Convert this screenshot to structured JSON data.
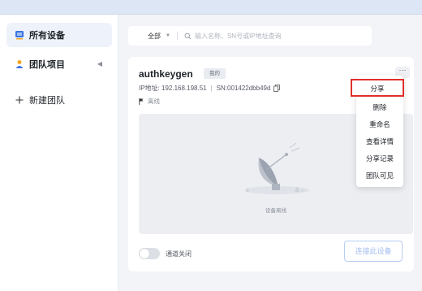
{
  "sidebar": {
    "items": [
      {
        "label": "所有设备",
        "icon": "devices-icon"
      },
      {
        "label": "团队项目",
        "icon": "team-icon"
      },
      {
        "label": "新建团队",
        "icon": "plus-icon"
      }
    ]
  },
  "search": {
    "filter_label": "全部",
    "placeholder": "输入名称、SN号或IP地址查询"
  },
  "device": {
    "name": "authkeygen",
    "badge": "我的",
    "ip_label": "IP地址: 192.168.198.51",
    "sn_label": "SN:001422dbb49d",
    "status": "离线",
    "preview_caption": "设备离线",
    "tunnel_label": "通道关闭",
    "tunnel_on": false,
    "connect_label": "连接此设备",
    "more_label": "···"
  },
  "menu": {
    "items": [
      "分享",
      "删除",
      "重命名",
      "查看详情",
      "分享记录",
      "团队可见"
    ],
    "highlighted": "分享"
  },
  "colors": {
    "accent": "#3b73e0",
    "highlight_border": "#e0302d",
    "card_bg": "#ffffff",
    "page_bg": "#f2f4f8"
  }
}
